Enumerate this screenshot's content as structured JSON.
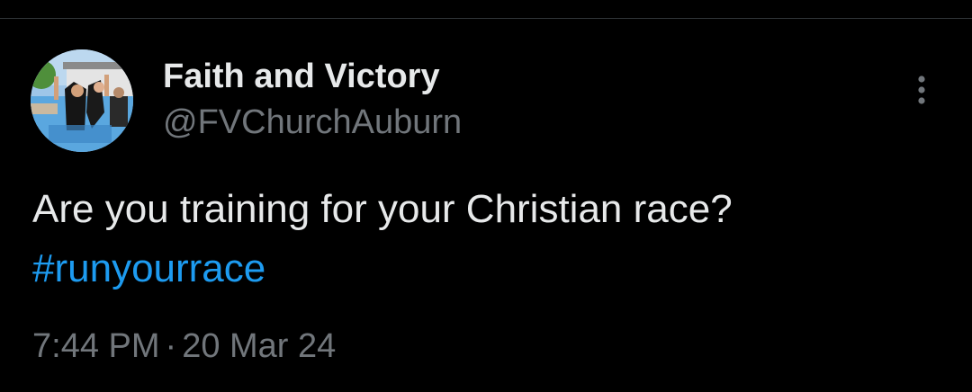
{
  "author": {
    "display_name": "Faith and Victory",
    "handle": "@FVChurchAuburn"
  },
  "tweet": {
    "text": "Are you training for your Christian race?",
    "hashtag": "#runyourrace"
  },
  "meta": {
    "time": "7:44 PM",
    "separator": "·",
    "date": "20 Mar 24"
  },
  "colors": {
    "background": "#000000",
    "text_primary": "#e7e9ea",
    "text_secondary": "#71767b",
    "link": "#1d9bf0"
  },
  "icons": {
    "more": "more-vertical-icon"
  }
}
